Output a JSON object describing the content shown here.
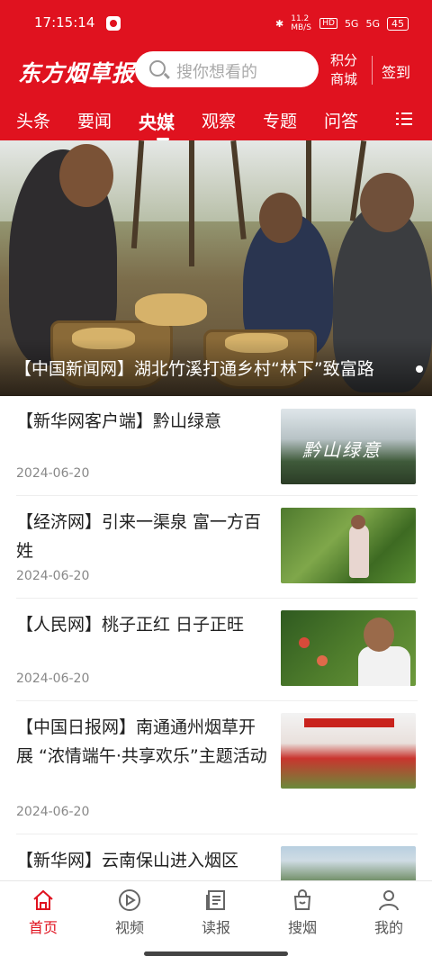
{
  "status": {
    "time": "17:15:14",
    "net_speed": "11.2 MB/S",
    "hd": "HD",
    "signal1": "5G",
    "signal2": "5G",
    "battery": "45"
  },
  "header": {
    "logo": "东方烟草报",
    "search_placeholder": "搜你想看的",
    "jifen": "积分",
    "shangcheng": "商城",
    "signin": "签到"
  },
  "tabs": [
    "头条",
    "要闻",
    "央媒",
    "观察",
    "专题",
    "问答"
  ],
  "active_tab": "央媒",
  "hero": {
    "caption": "【中国新闻网】湖北竹溪打通乡村“林下”致富路"
  },
  "news": [
    {
      "title": "【新华网客户端】黔山绿意",
      "date": "2024-06-20",
      "thumb_text": "黔山绿意"
    },
    {
      "title": "【经济网】引来一渠泉 富一方百姓",
      "date": "2024-06-20"
    },
    {
      "title": "【人民网】桃子正红 日子正旺",
      "date": "2024-06-20"
    },
    {
      "title": "【中国日报网】南通通州烟草开展 “浓情端午·共享欢乐”主题活动",
      "date": "2024-06-20"
    },
    {
      "title": "【新华网】云南保山进入烟区",
      "date": ""
    }
  ],
  "bottom_nav": [
    {
      "label": "首页",
      "icon": "home-icon",
      "active": true
    },
    {
      "label": "视频",
      "icon": "play-icon",
      "active": false
    },
    {
      "label": "读报",
      "icon": "newspaper-icon",
      "active": false
    },
    {
      "label": "搜烟",
      "icon": "bag-icon",
      "active": false
    },
    {
      "label": "我的",
      "icon": "user-icon",
      "active": false
    }
  ],
  "colors": {
    "brand_red": "#e0121f"
  }
}
